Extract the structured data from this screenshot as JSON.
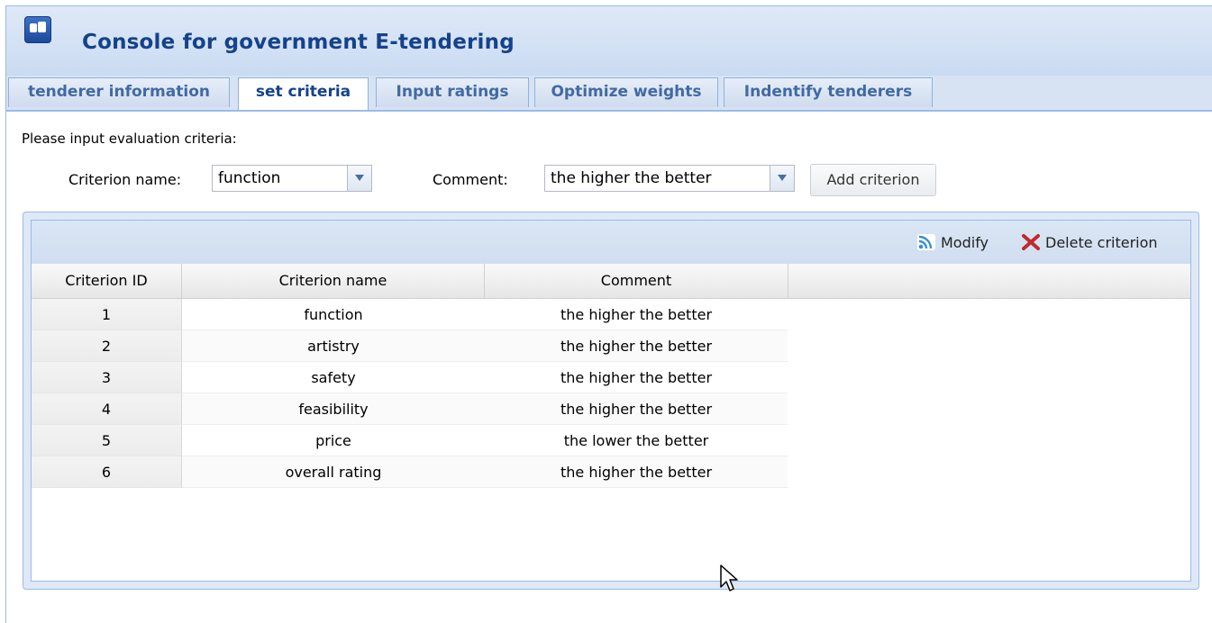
{
  "app": {
    "title": "Console for government E-tendering",
    "icon": "app-logo-icon"
  },
  "tabs": [
    {
      "label": "tenderer information",
      "active": false
    },
    {
      "label": "set criteria",
      "active": true
    },
    {
      "label": "Input ratings",
      "active": false
    },
    {
      "label": "Optimize weights",
      "active": false
    },
    {
      "label": "Indentify tenderers",
      "active": false
    }
  ],
  "form": {
    "prompt": "Please input evaluation criteria:",
    "criterion_name_label": "Criterion name:",
    "criterion_name_value": "function",
    "comment_label": "Comment:",
    "comment_value": "the higher the better",
    "add_button": "Add criterion"
  },
  "toolbar": {
    "modify_label": "Modify",
    "modify_icon": "rss-icon",
    "delete_label": "Delete criterion",
    "delete_icon": "red-x-icon"
  },
  "table": {
    "columns": [
      "Criterion ID",
      "Criterion name",
      "Comment"
    ],
    "rows": [
      [
        "1",
        "function",
        "the higher the better"
      ],
      [
        "2",
        "artistry",
        "the higher the better"
      ],
      [
        "3",
        "safety",
        "the higher the better"
      ],
      [
        "4",
        "feasibility",
        "the higher the better"
      ],
      [
        "5",
        "price",
        "the lower the better"
      ],
      [
        "6",
        "overall rating",
        "the higher the better"
      ]
    ]
  },
  "colors": {
    "title": "#15428b",
    "border": "#99bbe8",
    "delete": "#c0292b",
    "rss": "#f08a24"
  }
}
